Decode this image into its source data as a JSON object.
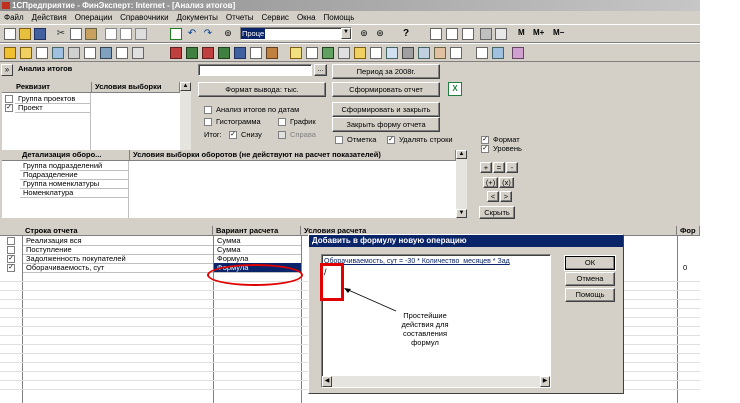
{
  "window": {
    "title": "1СПредприятие - ФинЭксперт: Internet - [Анализ итогов]"
  },
  "menu": [
    "Файл",
    "Действия",
    "Операции",
    "Справочники",
    "Документы",
    "Отчеты",
    "Сервис",
    "Окна",
    "Помощь"
  ],
  "toolbar": {
    "search_value": "Проце",
    "m_label": "M",
    "mplus_label": "M+",
    "mminus_label": "M−"
  },
  "panel": {
    "title": "Анализ итогов",
    "period_button": "Период за 2008г.",
    "format_button": "Формат вывода: тыс.",
    "generate_button": "Сформировать отчет",
    "generate_close_button": "Сформировать и закрыть",
    "close_form_button": "Закрыть форму отчета",
    "analysis_by_dates": "Анализ итогов по датам",
    "histogram": "Гистограмма",
    "graph": "График",
    "totals_label": "Итог:",
    "bottom_label": "Снизу",
    "right_label": "Справа",
    "mark_label": "Отметка",
    "delete_rows_label": "Удалять строки",
    "format_check": "Формат",
    "level_check": "Уровень",
    "hide_button": "Скрыть",
    "op_plus": "+",
    "op_eq": "=",
    "op_minus": "-",
    "op_paren_plus": "(+)",
    "op_paren_x": "(x)",
    "arrow_left": "<",
    "arrow_right": ">"
  },
  "requisites": {
    "col1": "Реквизит",
    "col2": "Условия выборки",
    "rows": [
      {
        "label": "Группа проектов",
        "checked": false
      },
      {
        "label": "Проект",
        "checked": true
      }
    ]
  },
  "details": {
    "col1": "Детализация оборо...",
    "col2": "Условия выборки оборотов (не действуют на расчет показателей)",
    "rows": [
      "Группа подразделений",
      "Подразделение",
      "Группа номенклатуры",
      "Номенклатура"
    ]
  },
  "report": {
    "col_row": "Строка отчета",
    "col_variant": "Вариант расчета",
    "col_cond": "Условия расчета",
    "col_format": "Фор",
    "rows": [
      {
        "label": "Реализация вся",
        "variant": "Сумма",
        "checked": false,
        "fmt": ""
      },
      {
        "label": "Поступление",
        "variant": "Сумма",
        "checked": false,
        "fmt": ""
      },
      {
        "label": "Задолженность покупателей",
        "variant": "Формула",
        "checked": true,
        "fmt": ""
      },
      {
        "label": "Оборачиваемость, сут",
        "variant": "Формула",
        "checked": true,
        "fmt": "0"
      }
    ]
  },
  "dialog": {
    "title": "Добавить в формулу новую операцию",
    "formula": "Оборачиваемость, сут = -30 * Количество_месяцев * Зад",
    "line2": "/",
    "ok": "ОК",
    "cancel": "Отмена",
    "help": "Помощь"
  },
  "annotation": {
    "lines": [
      "Простейшие",
      "действия для",
      "составления",
      "формул"
    ]
  },
  "colors": {
    "highlight": "#0a246a",
    "annotation_red": "#e00000",
    "dialog_title": "#0a246a",
    "window_bg": "#d4d0c8"
  }
}
